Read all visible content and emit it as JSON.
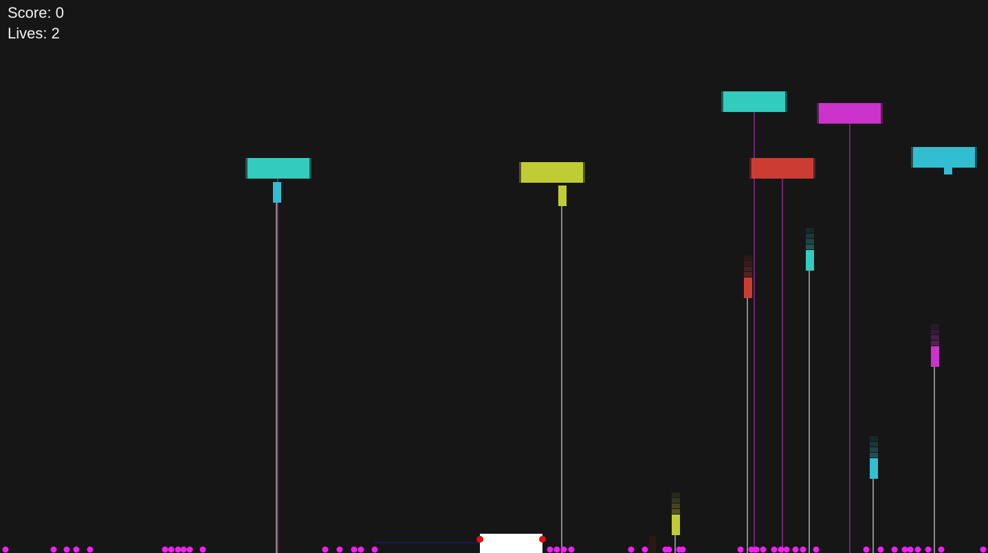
{
  "hud": {
    "score_label": "Score",
    "score_value": "0",
    "lives_label": "Lives",
    "lives_value": "2",
    "separator": ": "
  },
  "colors": {
    "background": "#161616",
    "teal": "#33cbbd",
    "cyan": "#33bdd0",
    "yellow": "#c0cc33",
    "magenta": "#cc33cc",
    "red": "#cc3c33",
    "paddle": "#ffffff",
    "paddle_laser": "#e0110f",
    "ground_dot": "#ee22ee",
    "aim_line": "#1a1aa0"
  },
  "enemies": [
    {
      "name": "enemy-ship-teal-left",
      "color": "teal"
    },
    {
      "name": "enemy-ship-yellow",
      "color": "yellow"
    },
    {
      "name": "enemy-ship-teal-top",
      "color": "teal"
    },
    {
      "name": "enemy-ship-magenta",
      "color": "magenta"
    },
    {
      "name": "enemy-ship-red",
      "color": "red"
    },
    {
      "name": "enemy-ship-cyan-right",
      "color": "cyan"
    }
  ],
  "projectiles": [
    {
      "name": "enemy-bomb-cyan-1",
      "color": "cyan"
    },
    {
      "name": "enemy-bomb-yellow-1",
      "color": "yellow"
    },
    {
      "name": "enemy-bomb-red",
      "color": "red"
    },
    {
      "name": "enemy-bomb-teal",
      "color": "teal"
    },
    {
      "name": "enemy-bomb-magenta",
      "color": "magenta"
    },
    {
      "name": "enemy-bomb-cyan-2",
      "color": "cyan"
    },
    {
      "name": "enemy-bomb-yellow-2",
      "color": "yellow"
    }
  ]
}
